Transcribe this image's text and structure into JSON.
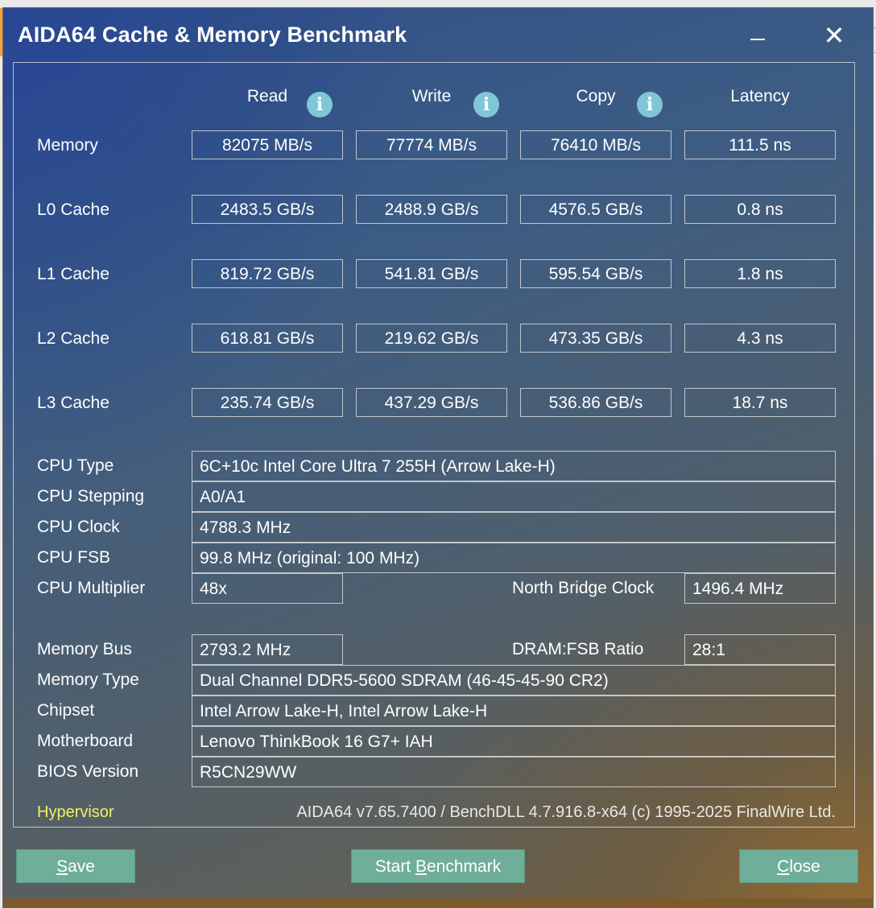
{
  "window": {
    "title": "AIDA64 Cache & Memory Benchmark",
    "close_glyph": "✕"
  },
  "columns": {
    "read": "Read",
    "write": "Write",
    "copy": "Copy",
    "latency": "Latency",
    "info_glyph": "i"
  },
  "rows": [
    {
      "label": "Memory",
      "read": "82075 MB/s",
      "write": "77774 MB/s",
      "copy": "76410 MB/s",
      "latency": "111.5 ns"
    },
    {
      "label": "L0 Cache",
      "read": "2483.5 GB/s",
      "write": "2488.9 GB/s",
      "copy": "4576.5 GB/s",
      "latency": "0.8 ns"
    },
    {
      "label": "L1 Cache",
      "read": "819.72 GB/s",
      "write": "541.81 GB/s",
      "copy": "595.54 GB/s",
      "latency": "1.8 ns"
    },
    {
      "label": "L2 Cache",
      "read": "618.81 GB/s",
      "write": "219.62 GB/s",
      "copy": "473.35 GB/s",
      "latency": "4.3 ns"
    },
    {
      "label": "L3 Cache",
      "read": "235.74 GB/s",
      "write": "437.29 GB/s",
      "copy": "536.86 GB/s",
      "latency": "18.7 ns"
    }
  ],
  "cpu": {
    "type_label": "CPU Type",
    "type": "6C+10c Intel Core Ultra 7 255H  (Arrow Lake-H)",
    "stepping_label": "CPU Stepping",
    "stepping": "A0/A1",
    "clock_label": "CPU Clock",
    "clock": "4788.3 MHz",
    "fsb_label": "CPU FSB",
    "fsb": "99.8 MHz  (original: 100 MHz)",
    "multiplier_label": "CPU Multiplier",
    "multiplier": "48x",
    "nb_clock_label": "North Bridge Clock",
    "nb_clock": "1496.4 MHz"
  },
  "memory": {
    "bus_label": "Memory Bus",
    "bus": "2793.2 MHz",
    "ratio_label": "DRAM:FSB Ratio",
    "ratio": "28:1",
    "type_label": "Memory Type",
    "type": "Dual Channel DDR5-5600 SDRAM  (46-45-45-90 CR2)",
    "chipset_label": "Chipset",
    "chipset": "Intel Arrow Lake-H, Intel Arrow Lake-H",
    "motherboard_label": "Motherboard",
    "motherboard": "Lenovo ThinkBook 16 G7+ IAH",
    "bios_label": "BIOS Version",
    "bios": "R5CN29WW"
  },
  "footer": {
    "hypervisor": "Hypervisor",
    "version": "AIDA64 v7.65.7400 / BenchDLL 4.7.916.8-x64  (c) 1995-2025 FinalWire Ltd."
  },
  "buttons": {
    "save_first": "S",
    "save_rest": "ave",
    "start_first": "Start ",
    "start_under": "B",
    "start_rest": "enchmark",
    "close_first": "C",
    "close_rest": "lose"
  },
  "colors": {
    "button": "#6fae98",
    "hypervisor": "#f0f060",
    "info": "#7fc6d6"
  }
}
